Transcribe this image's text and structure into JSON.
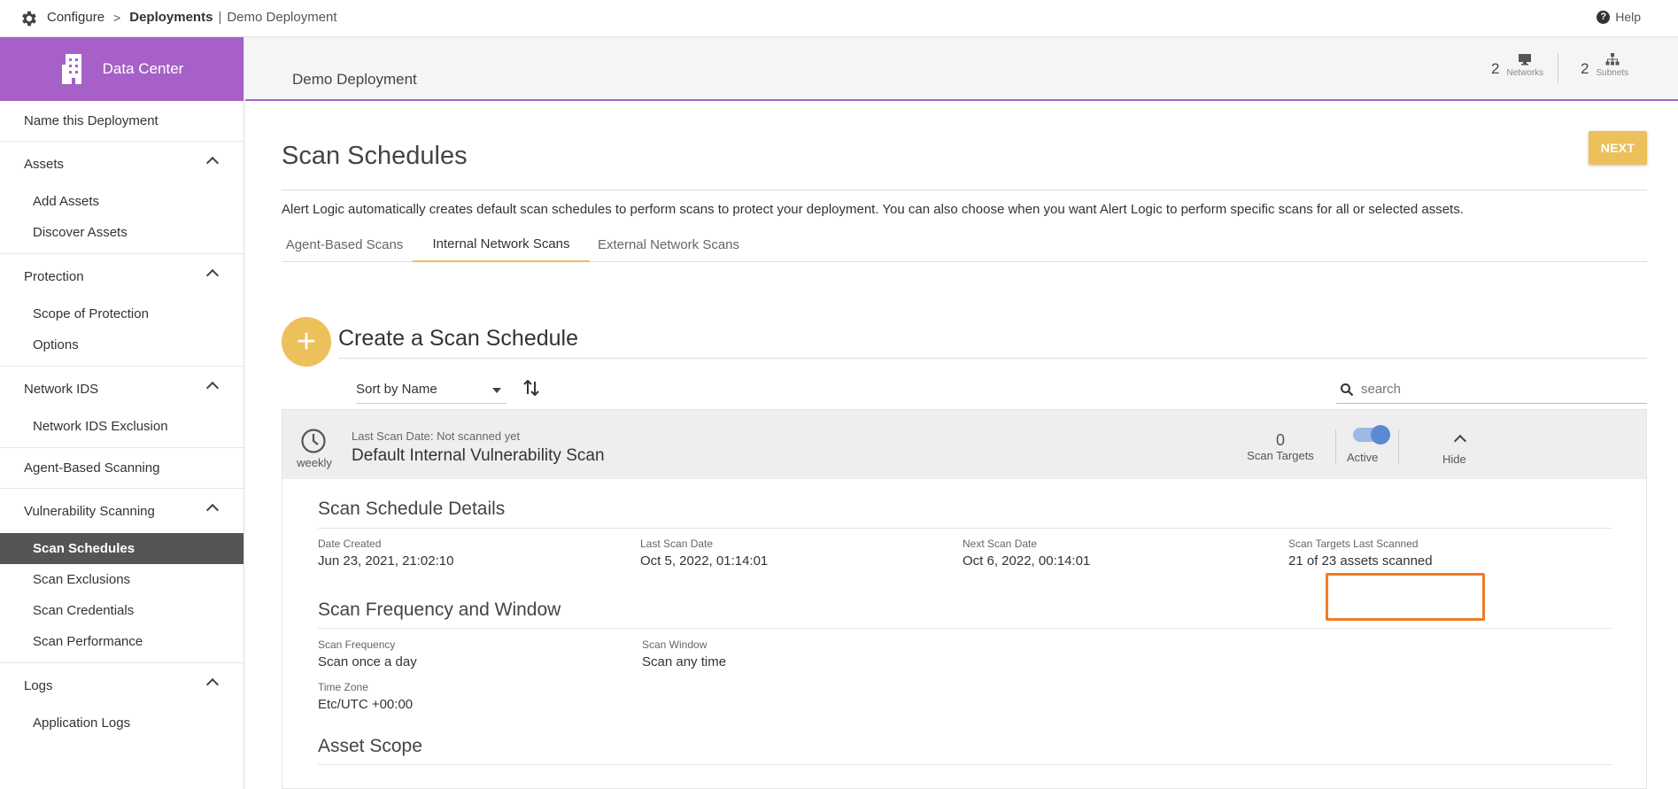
{
  "topbar": {
    "configure": "Configure",
    "deployments": "Deployments",
    "deployment_name": "Demo Deployment",
    "help": "Help"
  },
  "sidebar": {
    "header": "Data Center",
    "name_item": "Name this Deployment",
    "groups": [
      {
        "label": "Assets",
        "items": [
          "Add Assets",
          "Discover Assets"
        ]
      },
      {
        "label": "Protection",
        "items": [
          "Scope of Protection",
          "Options"
        ]
      },
      {
        "label": "Network IDS",
        "items": [
          "Network IDS Exclusion"
        ]
      }
    ],
    "agent_item": "Agent-Based Scanning",
    "vuln": {
      "label": "Vulnerability Scanning",
      "items": [
        "Scan Schedules",
        "Scan Exclusions",
        "Scan Credentials",
        "Scan Performance"
      ],
      "active": "Scan Schedules"
    },
    "logs": {
      "label": "Logs",
      "items": [
        "Application Logs"
      ]
    }
  },
  "deployment": {
    "title": "Demo Deployment",
    "networks_count": "2",
    "networks_label": "Networks",
    "subnets_count": "2",
    "subnets_label": "Subnets"
  },
  "page": {
    "title": "Scan Schedules",
    "next_button": "NEXT",
    "description": "Alert Logic automatically creates default scan schedules to perform scans to protect your deployment. You can also choose when you want Alert Logic to perform specific scans for all or selected assets."
  },
  "tabs": [
    {
      "label": "Agent-Based Scans"
    },
    {
      "label": "Internal Network Scans",
      "active": true
    },
    {
      "label": "External Network Scans"
    }
  ],
  "create": {
    "plus": "+",
    "label": "Create a Scan Schedule"
  },
  "toolbar": {
    "sort_value": "Sort by Name",
    "search_placeholder": "search"
  },
  "schedule": {
    "frequency_short": "weekly",
    "last_scan": "Last Scan Date: Not scanned yet",
    "name": "Default Internal Vulnerability Scan",
    "targets_count": "0",
    "targets_label": "Scan Targets",
    "active_label": "Active",
    "hide_label": "Hide",
    "details_title": "Scan Schedule Details",
    "date_created_label": "Date Created",
    "date_created": "Jun 23, 2021, 21:02:10",
    "last_scan_date_label": "Last Scan Date",
    "last_scan_date": "Oct 5, 2022, 01:14:01",
    "next_scan_date_label": "Next Scan Date",
    "next_scan_date": "Oct 6, 2022, 00:14:01",
    "targets_last_label": "Scan Targets Last Scanned",
    "targets_last": "21 of 23 assets scanned",
    "freq_title": "Scan Frequency and Window",
    "scan_frequency_label": "Scan Frequency",
    "scan_frequency": "Scan once a day",
    "scan_window_label": "Scan Window",
    "scan_window": "Scan any time",
    "time_zone_label": "Time Zone",
    "time_zone": "Etc/UTC +00:00",
    "asset_scope_title": "Asset Scope"
  },
  "colors": {
    "accent_purple": "#a660c8",
    "accent_gold": "#ecc05a",
    "highlight_orange": "#ee7c2a",
    "active_nav": "#555555"
  }
}
